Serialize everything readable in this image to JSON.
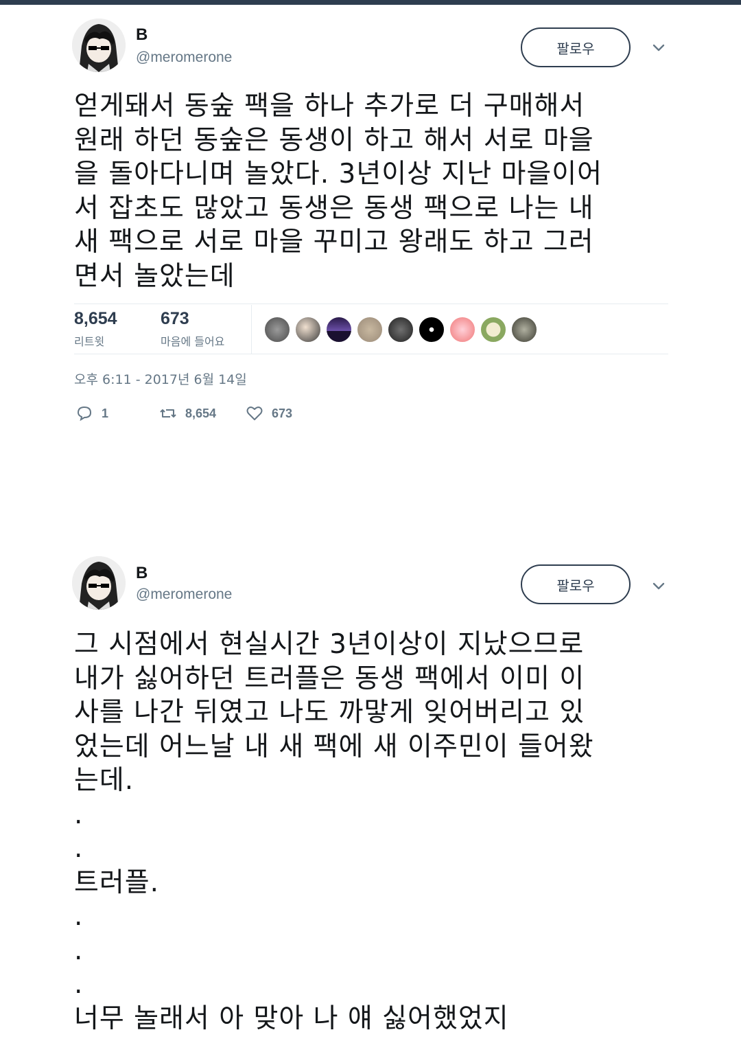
{
  "tweets": [
    {
      "author": {
        "name": "B",
        "handle": "@meromerone"
      },
      "follow_label": "팔로우",
      "text": "얻게돼서 동숲 팩을 하나 추가로 더 구매해서\n원래 하던 동숲은 동생이 하고 해서 서로 마을\n을 돌아다니며 놀았다. 3년이상 지난 마을이어\n서 잡초도 많았고 동생은 동생 팩으로 나는 내\n새 팩으로 서로 마을 꾸미고 왕래도 하고 그러\n면서 놀았는데",
      "stats": {
        "retweets": "8,654",
        "retweets_label": "리트윗",
        "likes": "673",
        "likes_label": "마음에 들어요"
      },
      "timestamp": "오후 6:11 - 2017년 6월 14일",
      "actions": {
        "replies": "1",
        "retweets": "8,654",
        "likes": "673"
      }
    },
    {
      "author": {
        "name": "B",
        "handle": "@meromerone"
      },
      "follow_label": "팔로우",
      "text": "그 시점에서 현실시간 3년이상이 지났으므로\n내가 싫어하던 트러플은 동생 팩에서 이미 이\n사를 나간 뒤였고 나도 까맣게 잊어버리고 있\n었는데 어느날 내 새 팩에 새 이주민이 들어왔\n는데.\n.\n.\n트러플.\n.\n.\n.\n너무 놀래서 아 맞아 나 얘 싫어했었지"
    }
  ],
  "colors": {
    "accent": "#2e3d4f",
    "muted": "#657786",
    "divider": "#e6ecf0"
  }
}
